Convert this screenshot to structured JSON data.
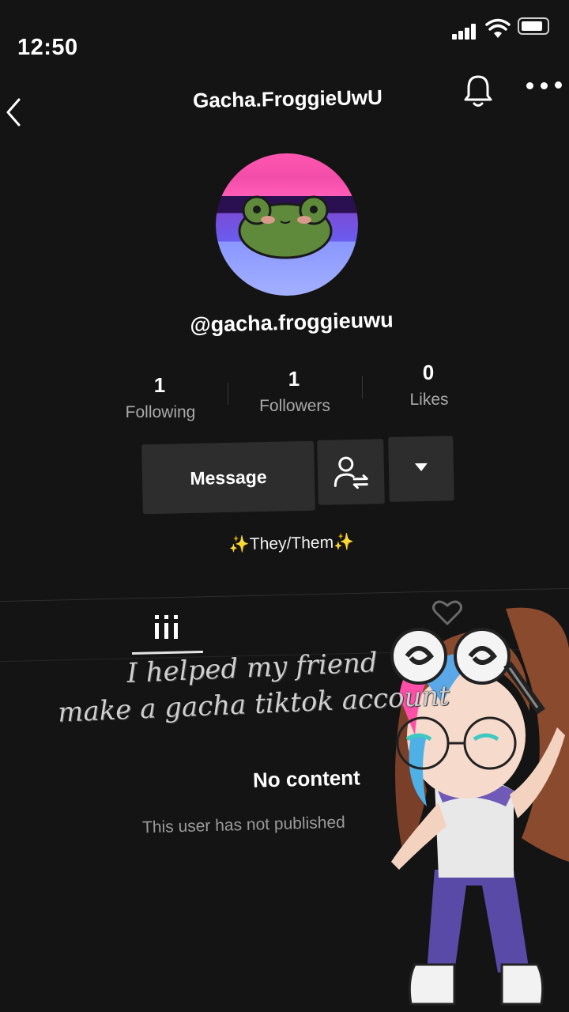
{
  "status_bar": {
    "time": "12:50"
  },
  "header": {
    "title": "Gacha.FroggieUwU"
  },
  "profile": {
    "username": "@gacha.froggieuwu",
    "stats": [
      {
        "value": "1",
        "label": "Following"
      },
      {
        "value": "1",
        "label": "Followers"
      },
      {
        "value": "0",
        "label": "Likes"
      }
    ],
    "message_label": "Message",
    "bio": "✨They/Them✨"
  },
  "overlay": {
    "caption_line1": "I helped my friend",
    "caption_line2": "make a gacha tiktok account"
  },
  "empty_state": {
    "title": "No content",
    "subtitle": "This user has not published"
  },
  "colors": {
    "background": "#141414",
    "button": "#2d2d2d"
  }
}
